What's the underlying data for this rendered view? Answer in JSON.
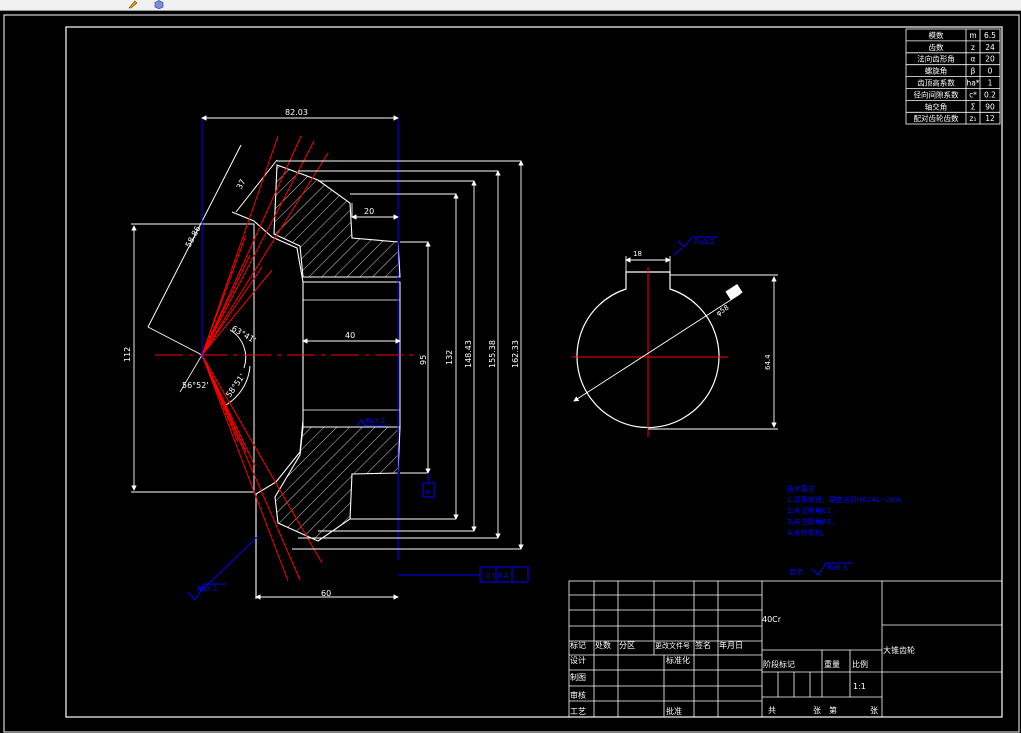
{
  "toolbar": {
    "icons": [
      "pencil-icon",
      "cube-icon"
    ]
  },
  "colors": {
    "background": "#000000",
    "outline": "#ffffff",
    "centerline": "#ff0000",
    "dimension": "#0000ff",
    "blue_text": "#0000ff"
  },
  "params_table": [
    {
      "name": "模数",
      "sym": "m",
      "val": "6.5"
    },
    {
      "name": "齿数",
      "sym": "z",
      "val": "24"
    },
    {
      "name": "法向齿形角",
      "sym": "α",
      "val": "20"
    },
    {
      "name": "螺旋角",
      "sym": "β",
      "val": "0"
    },
    {
      "name": "齿顶高系数",
      "sym": "ha*",
      "val": "1"
    },
    {
      "name": "径向间隙系数",
      "sym": "c*",
      "val": "0.2"
    },
    {
      "name": "轴交角",
      "sym": "Σ",
      "val": "90"
    },
    {
      "name": "配对齿轮齿数",
      "sym": "z₁",
      "val": "12"
    }
  ],
  "dims": {
    "width_top": "82.03",
    "cone": "58.86",
    "face": "37",
    "hub_step": "20",
    "bore_len": "40",
    "d_95": "95",
    "d_132": "132",
    "d_148": "148.43",
    "d_155": "155.38",
    "d_162": "162.33",
    "height_112": "112",
    "bottom_60": "60",
    "angle_1": "63°41'",
    "angle_2": "56°52'",
    "angle_3": "58°51'",
    "key_width": "18",
    "key_depth": "64.4",
    "bore_dia": "φ58"
  },
  "rough": {
    "r1": "Ra3.2",
    "r2": "Ra3.2",
    "r3": "Ra3.2",
    "r4": "Ra6.3",
    "other": "其余",
    "tol_frame": "0.03 A",
    "datum": "A"
  },
  "notes": {
    "title": "技术要求",
    "lines": [
      "1.调质处理，硬度达到HB241~269。",
      "2.未注倒角C1。",
      "3.未注圆角R1。",
      "4.去除毛刺。"
    ]
  },
  "title_block": {
    "material": "40Cr",
    "part_name": "大锥齿轮",
    "row_labels": [
      "标记",
      "处数",
      "分区",
      "更改文件号",
      "签名",
      "年月日"
    ],
    "left_labels": [
      "设计",
      "制图",
      "审核",
      "工艺"
    ],
    "standardize": "标准化",
    "approve": "批准",
    "stage": "阶段标记",
    "weight": "重量",
    "scale_label": "比例",
    "scale": "1:1",
    "sheet": [
      "共",
      "张",
      "第",
      "张"
    ]
  }
}
